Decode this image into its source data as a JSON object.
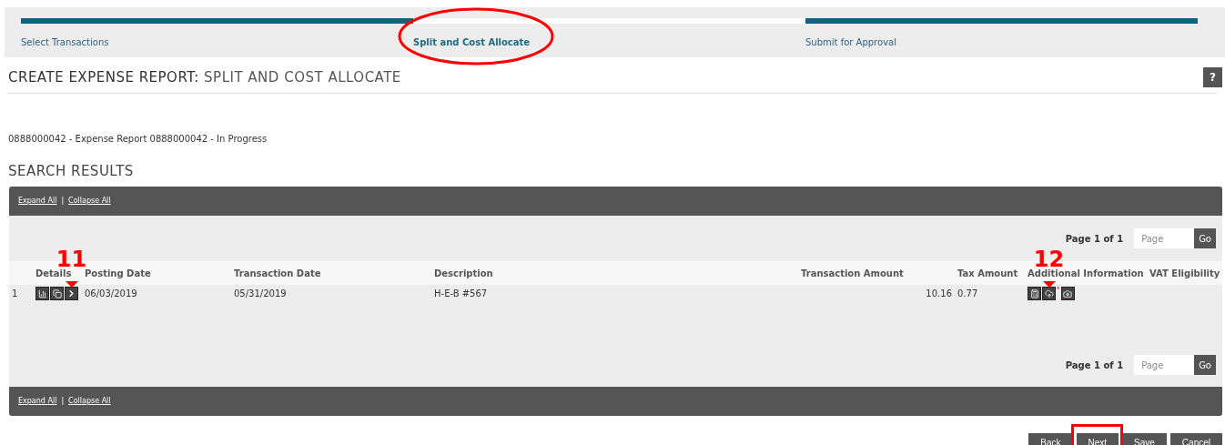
{
  "steps": [
    {
      "label": "Select Transactions",
      "selected": false,
      "circled": false
    },
    {
      "label": "Split and Cost Allocate",
      "selected": true,
      "circled": true
    },
    {
      "label": "Submit for Approval",
      "selected": false,
      "circled": false
    }
  ],
  "page_title": {
    "prefix": "CREATE EXPENSE REPORT:",
    "text": "SPLIT AND COST ALLOCATE"
  },
  "help_button": "?",
  "report_info": "0888000042 - Expense Report 0888000042 - In Progress",
  "section_title": "SEARCH RESULTS",
  "panel": {
    "top_links": [
      "Expand All",
      "|",
      "Collapse All"
    ],
    "top_pager": {
      "label": "Page 1 of 1",
      "placeholder": "Page",
      "button": "Go"
    },
    "columns": [
      "Details",
      "Posting Date",
      "Transaction Date",
      "Description",
      "Transaction Amount",
      "Tax Amount",
      "Additional Information",
      "VAT Eligibility"
    ],
    "rows": [
      {
        "number": "1",
        "posting_date": "06/03/2019",
        "transaction_date": "05/31/2019",
        "description": "H-E-B #567",
        "transaction_amount": "10.16",
        "tax_amount": "0.77",
        "required_mark": "*",
        "details_callout": "11",
        "info_callout": "12"
      }
    ],
    "bottom_pager": {
      "label": "Page 1 of 1",
      "placeholder": "Page",
      "button": "Go"
    },
    "bottom_links": [
      "Expand All",
      "|",
      "Collapse All"
    ]
  },
  "buttons": [
    {
      "label": "Back",
      "highlighted": false
    },
    {
      "label": "Next",
      "highlighted": true
    },
    {
      "label": "Save",
      "highlighted": false
    },
    {
      "label": "Cancel",
      "highlighted": false
    }
  ]
}
